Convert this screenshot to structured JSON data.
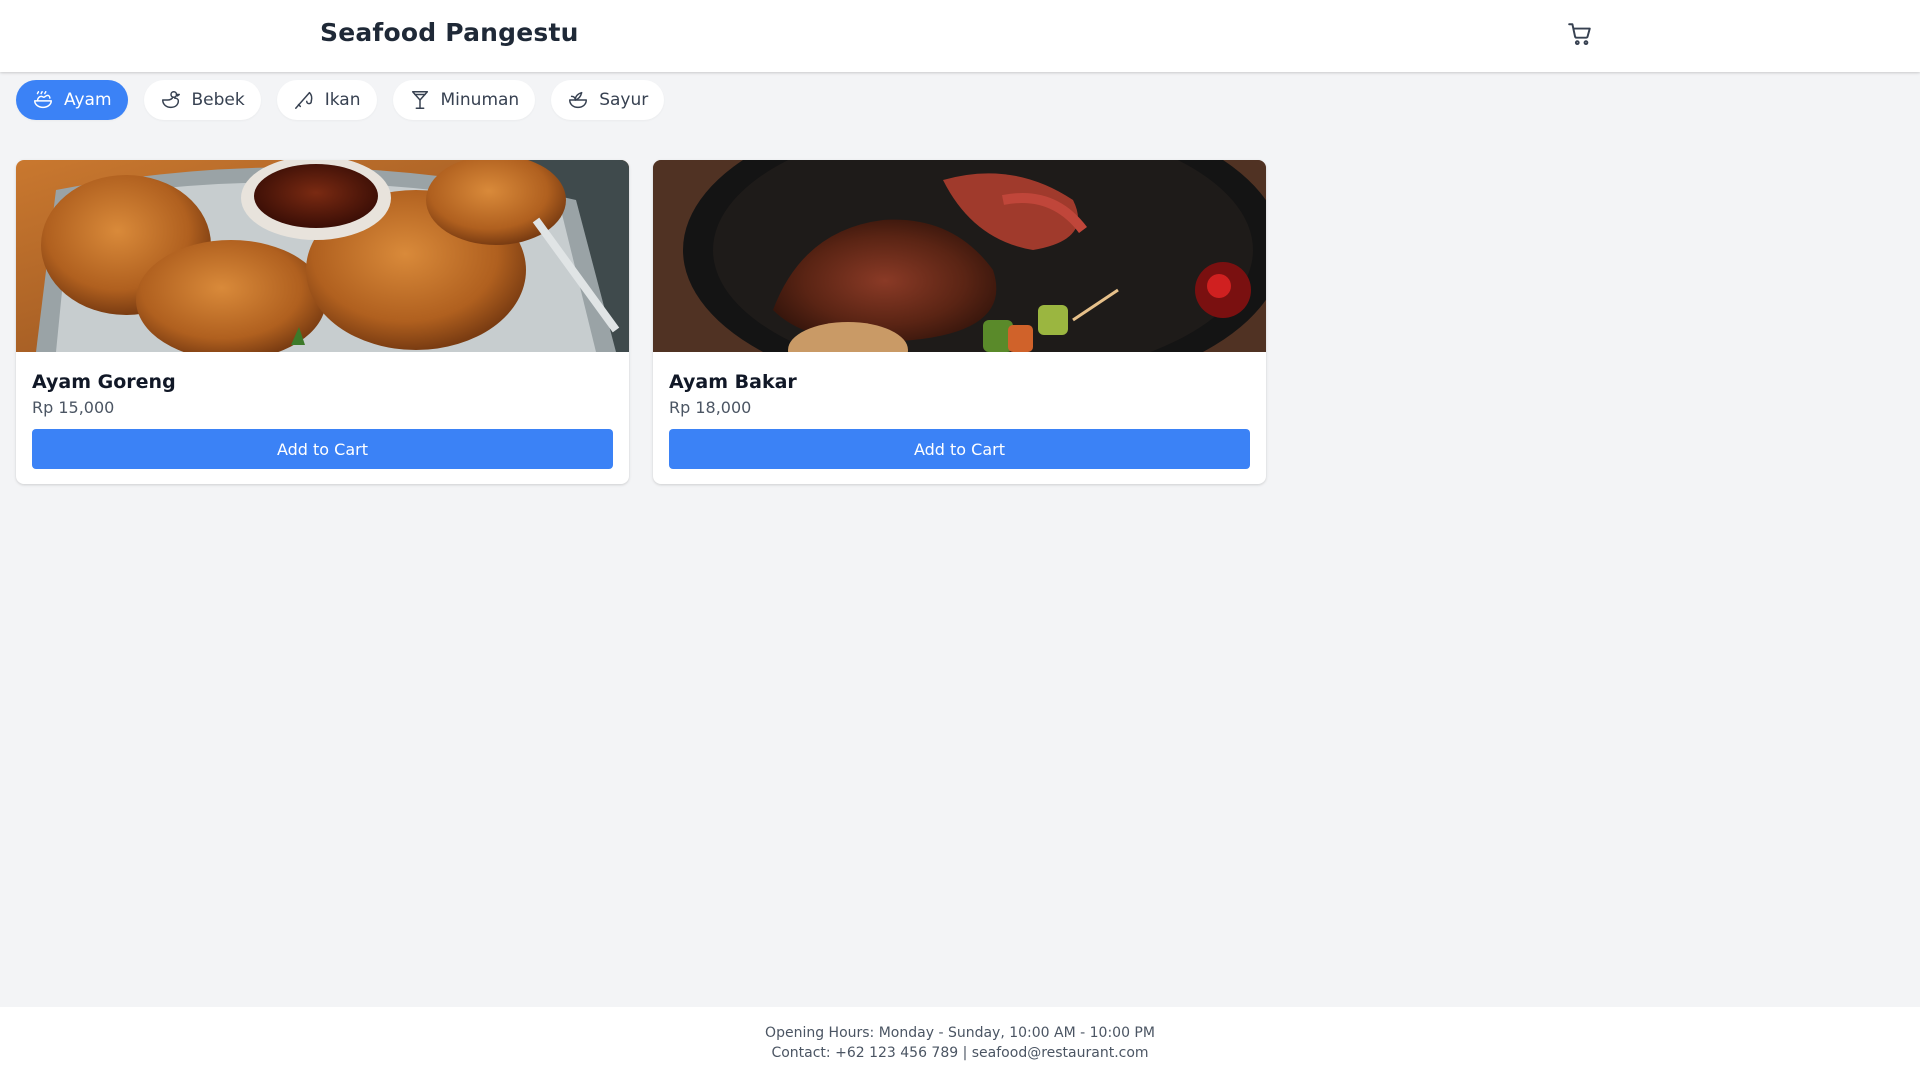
{
  "header": {
    "title": "Seafood Pangestu",
    "cart_icon": "shopping-cart-icon"
  },
  "categories": [
    {
      "label": "Ayam",
      "icon": "chicken-icon",
      "active": true
    },
    {
      "label": "Bebek",
      "icon": "duck-icon",
      "active": false
    },
    {
      "label": "Ikan",
      "icon": "fishing-icon",
      "active": false
    },
    {
      "label": "Minuman",
      "icon": "cocktail-glass-icon",
      "active": false
    },
    {
      "label": "Sayur",
      "icon": "vegetable-bowl-icon",
      "active": false
    }
  ],
  "products": [
    {
      "name": "Ayam Goreng",
      "price": "Rp 15,000",
      "button": "Add to Cart",
      "image": "fried-chicken-photo"
    },
    {
      "name": "Ayam Bakar",
      "price": "Rp 18,000",
      "button": "Add to Cart",
      "image": "grilled-meat-photo"
    }
  ],
  "footer": {
    "hours": "Opening Hours: Monday - Sunday, 10:00 AM - 10:00 PM",
    "contact": "Contact: +62 123 456 789 | seafood@restaurant.com"
  },
  "colors": {
    "accent": "#3b82f6",
    "background": "#f3f4f6",
    "text": "#1f2937"
  }
}
